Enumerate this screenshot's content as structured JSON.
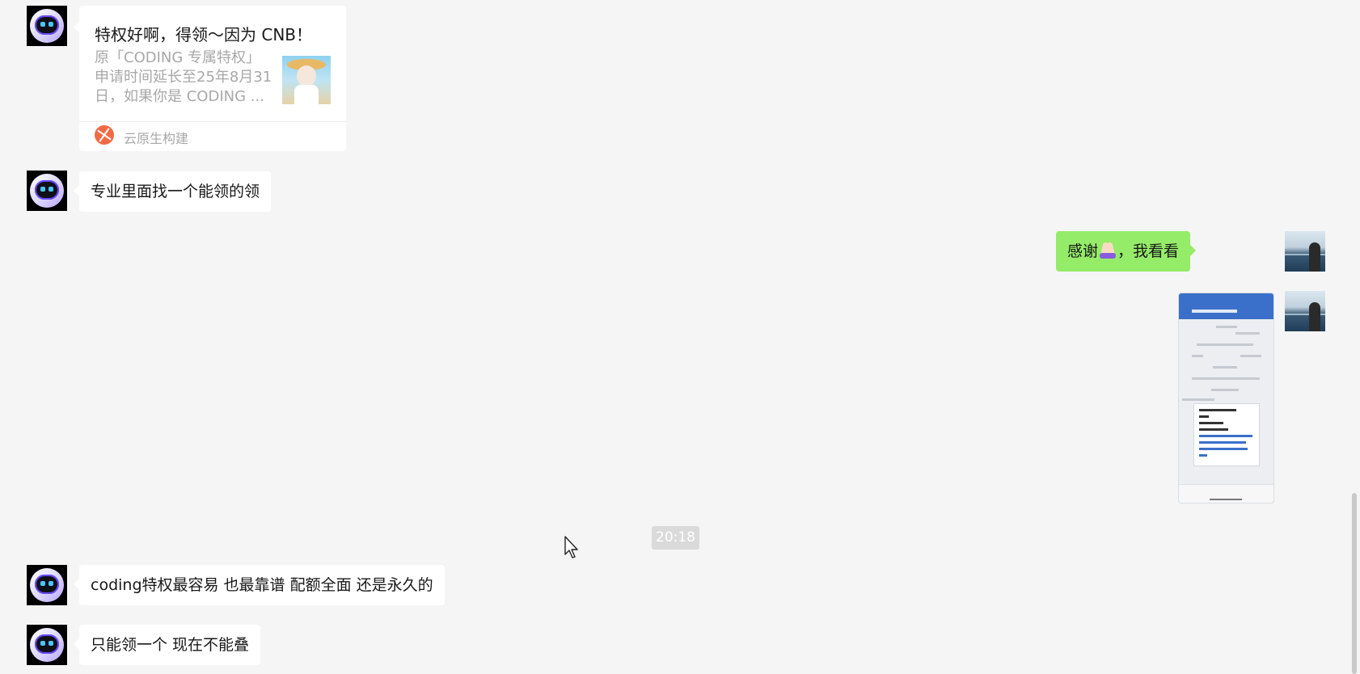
{
  "chat": {
    "messages": [
      {
        "kind": "link-card",
        "sender": "bot",
        "title": "特权好啊，得领～因为 CNB！",
        "description": "原「CODING 专属特权」\n申请时间延长至25年8月31\n日，如果你是 CODING ...",
        "source": "云原生构建"
      },
      {
        "kind": "text",
        "sender": "bot",
        "text": "专业里面找一个能领的领"
      },
      {
        "kind": "text",
        "sender": "me",
        "text_before": "感谢",
        "emoji": "pray-hands-emoji",
        "text_after": "，我看看"
      },
      {
        "kind": "image",
        "sender": "me"
      },
      {
        "kind": "text",
        "sender": "bot",
        "text": "coding特权最容易 也最靠谱 配额全面 还是永久的"
      },
      {
        "kind": "text",
        "sender": "bot",
        "text": "只能领一个 现在不能叠"
      }
    ],
    "timestamp": "20:18"
  },
  "colors": {
    "background": "#f5f5f5",
    "incoming_bubble": "#ffffff",
    "outgoing_bubble": "#95ec69",
    "timestamp_bg": "#dadada",
    "source_icon": "#f06b45"
  }
}
